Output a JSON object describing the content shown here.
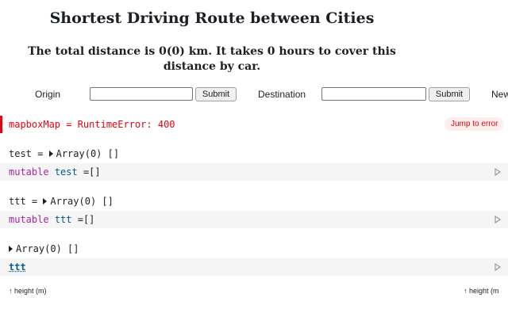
{
  "page": {
    "title": "Shortest Driving Route between Cities",
    "summary": "The total distance is 0(0) km. It takes 0 hours to cover this distance by car."
  },
  "form": {
    "origin_label": "Origin",
    "origin_value": "",
    "destination_label": "Destination",
    "destination_value": "",
    "submit_label": "Submit",
    "next_label": "New"
  },
  "error": {
    "message": "mapboxMap = RuntimeError: 400",
    "jump_label": "Jump to error",
    "color": "#e7040f"
  },
  "cells": [
    {
      "output_name": "test",
      "output_value": "Array(0) []",
      "code_keyword": "mutable",
      "code_var": "test",
      "code_rest": "=[]"
    },
    {
      "output_name": "ttt",
      "output_value": "Array(0) []",
      "code_keyword": "mutable",
      "code_var": "ttt",
      "code_rest": "=[]"
    },
    {
      "output_value": "Array(0) []",
      "code_ref": "ttt"
    }
  ],
  "footer": {
    "left_label": "↑ height (m)",
    "right_label": "↑ height (m"
  },
  "icons": {
    "run": "run-cell-icon",
    "expand": "disclosure-triangle-icon"
  }
}
